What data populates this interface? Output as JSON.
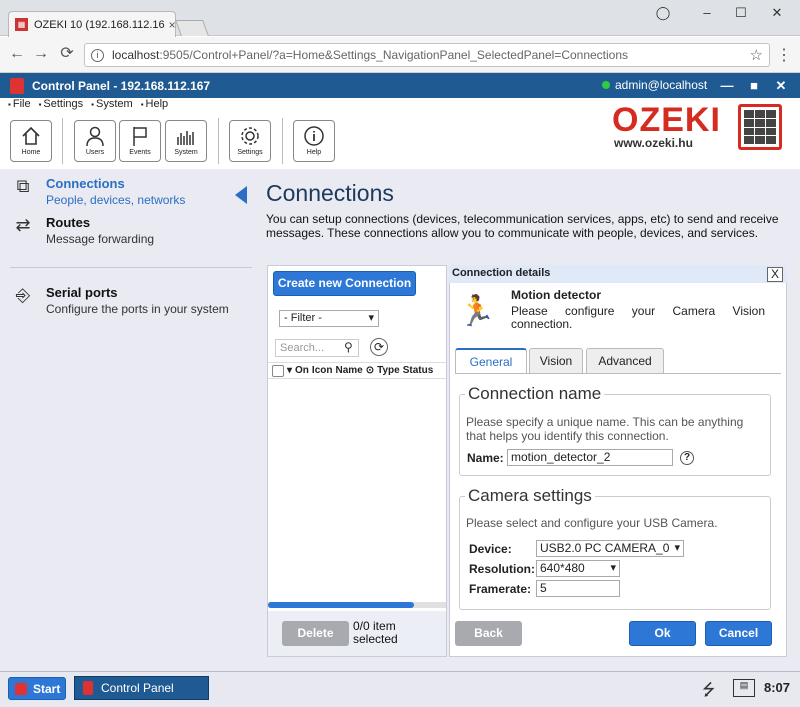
{
  "browser": {
    "tab_title": "OZEKI 10 (192.168.112.16",
    "tab_close": "×",
    "url_host": "localhost",
    "url_rest": ":9505/Control+Panel/?a=Home&Settings_NavigationPanel_SelectedPanel=Connections",
    "back": "←",
    "forward": "→",
    "reload": "⟳",
    "star": "☆",
    "menu": "⋮",
    "minimize": "–",
    "maximize": "☐",
    "close": "✕",
    "profile": "👤"
  },
  "app": {
    "title": "Control Panel - 192.168.112.167",
    "user": "admin@localhost",
    "minimize": "—",
    "maximize": "■",
    "close": "✕"
  },
  "menu": [
    "File",
    "Settings",
    "System",
    "Help"
  ],
  "toolbar": [
    {
      "label": "Home",
      "icon": "home-icon"
    },
    {
      "label": "Users",
      "icon": "user-icon"
    },
    {
      "label": "Events",
      "icon": "flag-icon"
    },
    {
      "label": "System",
      "icon": "bars-icon"
    },
    {
      "label": "Settings",
      "icon": "gear-icon"
    },
    {
      "label": "Help",
      "icon": "info-icon"
    }
  ],
  "brand": {
    "name": "OZEKI",
    "url": "www.ozeki.hu"
  },
  "nav": [
    {
      "title": "Connections",
      "subtitle": "People, devices, networks",
      "selected": true,
      "icon": "connections-icon"
    },
    {
      "title": "Routes",
      "subtitle": "Message forwarding",
      "selected": false,
      "icon": "routes-icon"
    },
    {
      "title": "Serial ports",
      "subtitle": "Configure the ports in your system",
      "selected": false,
      "icon": "serial-port-icon"
    }
  ],
  "page": {
    "title": "Connections",
    "description": "You can setup connections (devices, telecommunication services, apps, etc) to send and receive messages. These connections allow you to communicate with people, devices, and services."
  },
  "list": {
    "create_label": "Create new Connection",
    "filter_value": "- Filter -",
    "search_placeholder": "Search...",
    "columns": [
      "On",
      "Icon",
      "Name",
      "Type",
      "Status"
    ],
    "delete_label": "Delete",
    "selection_line1": "0/0 item",
    "selection_line2": "selected",
    "progress": 0.82
  },
  "details": {
    "header": "Connection details",
    "close": "X",
    "name": "Motion detector",
    "description": "Please configure your Camera Vision connection.",
    "tabs": [
      "General",
      "Vision",
      "Advanced"
    ],
    "active_tab": "General",
    "connection_name": {
      "legend": "Connection name",
      "hint": "Please specify a unique name. This can be anything that helps you identify this connection.",
      "label": "Name:",
      "value": "motion_detector_2",
      "help": "?"
    },
    "camera": {
      "legend": "Camera settings",
      "hint": "Please select and configure your USB Camera.",
      "device_label": "Device:",
      "device_value": "USB2.0 PC CAMERA_0",
      "resolution_label": "Resolution:",
      "resolution_value": "640*480",
      "framerate_label": "Framerate:",
      "framerate_value": "5"
    },
    "back_label": "Back",
    "ok_label": "Ok",
    "cancel_label": "Cancel"
  },
  "taskbar": {
    "start_label": "Start",
    "app_label": "Control Panel",
    "clock": "8:07"
  },
  "colors": {
    "accent": "#2d78d6",
    "header": "#1f5a93",
    "brand_red": "#d62b20"
  }
}
